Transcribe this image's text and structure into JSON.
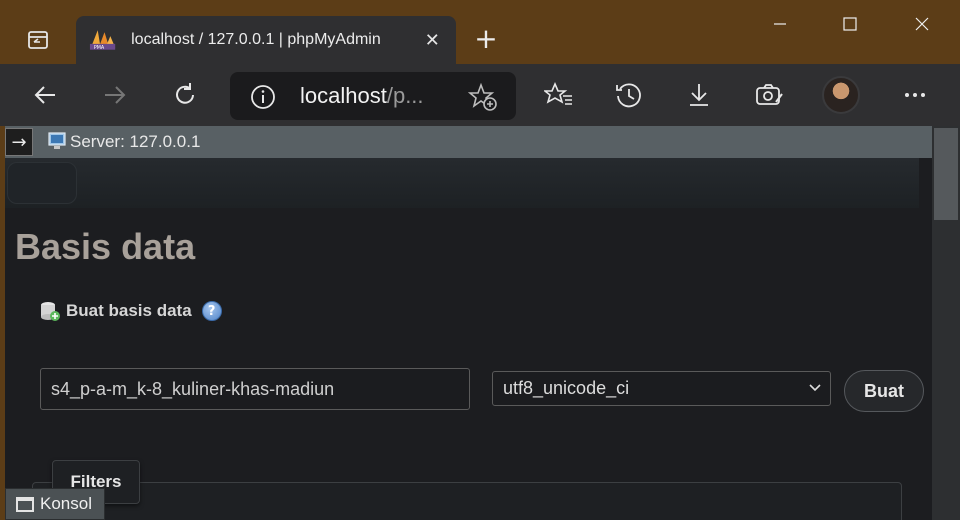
{
  "browser": {
    "tab_title": "localhost / 127.0.0.1 | phpMyAdmin",
    "tab_close": "✕",
    "new_tab": "+",
    "url_host": "localhost",
    "url_rest": "/p...",
    "window_controls": {
      "minimize": "—",
      "maximize": "☐",
      "close": "✕"
    },
    "icons": [
      "tab-actions-icon",
      "back-icon",
      "forward-icon",
      "refresh-icon",
      "info-icon",
      "add-favorite-icon",
      "favorites-icon",
      "history-icon",
      "downloads-icon",
      "screenshot-icon",
      "profile-avatar",
      "more-icon"
    ]
  },
  "pma": {
    "nav_toggle": "→",
    "server_label": "Server: 127.0.0.1",
    "page_title": "Basis data",
    "create_section": {
      "label": "Buat basis data",
      "help": "?",
      "db_name_value": "s4_p-a-m_k-8_kuliner-khas-madiun",
      "collation_value": "utf8_unicode_ci",
      "create_button": "Buat"
    },
    "filters_label": "Filters",
    "console_label": "Konsol"
  },
  "colors": {
    "titlebar": "#5c3d17",
    "toolbar": "#2f2f31",
    "page_bg": "#1c1d20",
    "server_bar": "#586064",
    "title_text": "#a8a19a"
  }
}
